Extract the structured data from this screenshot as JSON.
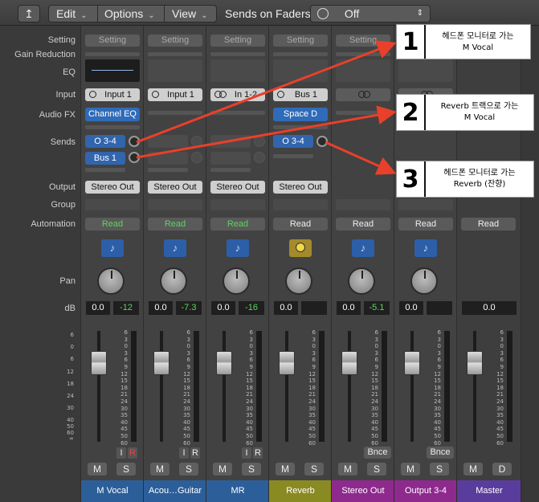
{
  "toolbar": {
    "back_icon": "back-arrow-icon",
    "edit": "Edit",
    "options": "Options",
    "view": "View",
    "sends_on_faders_label": "Sends on Faders:",
    "sends_on_faders_value": "Off"
  },
  "row_labels": {
    "setting": "Setting",
    "gain_reduction": "Gain Reduction",
    "eq": "EQ",
    "input": "Input",
    "audio_fx": "Audio FX",
    "sends": "Sends",
    "output": "Output",
    "group": "Group",
    "automation": "Automation",
    "pan": "Pan",
    "db": "dB"
  },
  "setting_label": "Setting",
  "strips": [
    {
      "name": "M Vocal",
      "color": "#2c5f99",
      "input": "Input 1",
      "audio_fx": "Channel EQ",
      "sends": [
        "O 3-4",
        "Bus 1"
      ],
      "output": "Stereo Out",
      "automation": "Read",
      "vol": "0.0",
      "peak": "-12",
      "i": "I",
      "r": "R",
      "m": "M",
      "s": "S"
    },
    {
      "name": "Acou…Guitar",
      "color": "#2c5f99",
      "input": "Input 1",
      "output": "Stereo Out",
      "automation": "Read",
      "vol": "0.0",
      "peak": "-7.3",
      "i": "I",
      "r": "R",
      "m": "M",
      "s": "S"
    },
    {
      "name": "MR",
      "color": "#2c5f99",
      "input": "In 1-2",
      "output": "Stereo Out",
      "automation": "Read",
      "vol": "0.0",
      "peak": "-16",
      "i": "I",
      "r": "R",
      "m": "M",
      "s": "S"
    },
    {
      "name": "Reverb",
      "color": "#8a8a22",
      "input": "Bus 1",
      "audio_fx": "Space D",
      "sends": [
        "O 3-4"
      ],
      "output": "Stereo Out",
      "automation": "Read",
      "vol": "0.0",
      "peak": "",
      "m": "M",
      "s": "S"
    },
    {
      "name": "Stereo Out",
      "color": "#8e2a8e",
      "automation": "Read",
      "vol": "0.0",
      "peak": "-5.1",
      "bnce": "Bnce",
      "m": "M",
      "s": "S"
    },
    {
      "name": "Output 3-4",
      "color": "#8e2a8e",
      "automation": "Read",
      "vol": "0.0",
      "peak": "",
      "bnce": "Bnce",
      "m": "M",
      "s": "S"
    },
    {
      "name": "Master",
      "color": "#5a3c9c",
      "automation": "Read",
      "vol": "0.0",
      "m": "M",
      "d": "D"
    }
  ],
  "db_scale": [
    "6",
    "3",
    "0",
    "3",
    "6",
    "9",
    "12",
    "15",
    "18",
    "21",
    "24",
    "30",
    "35",
    "40",
    "45",
    "50",
    "60"
  ],
  "left_scale": [
    "6",
    "",
    "0",
    "",
    "6",
    "",
    "12",
    "",
    "18",
    "",
    "24",
    "",
    "30",
    "",
    "40",
    "50",
    "60",
    "∞"
  ],
  "callouts": [
    {
      "num": "1",
      "lines": [
        "헤드폰 모니터로 가는",
        "M Vocal"
      ]
    },
    {
      "num": "2",
      "lines": [
        "Reverb 트랙으로 가는",
        "M Vocal"
      ]
    },
    {
      "num": "3",
      "lines": [
        "헤드폰 모니터로 가는",
        "Reverb (잔향)"
      ]
    }
  ],
  "colors": {
    "arrow": "#e8402a",
    "send_blue": "#3165ad",
    "read_green": "#5fd35f"
  }
}
